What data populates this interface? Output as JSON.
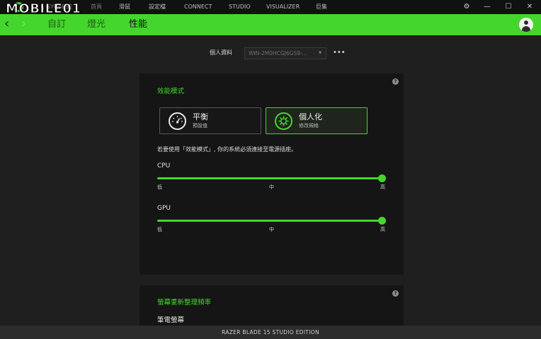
{
  "watermark": "MOBILE01",
  "topnav": {
    "items": [
      "SYNAPSE",
      "首頁",
      "滑鼠",
      "設定檔",
      "CONNECT",
      "STUDIO",
      "VISUALIZER",
      "巨集"
    ]
  },
  "window_controls": {
    "settings": "⚙",
    "minimize": "—",
    "maximize": "☐",
    "close": "✕"
  },
  "header": {
    "tabs": [
      "自訂",
      "燈光",
      "性能"
    ],
    "active_tab": "性能"
  },
  "profile": {
    "label": "個人資料",
    "value": "WIN-2M0HCGJ6GS9-...",
    "more": "•••"
  },
  "performance": {
    "title": "效能模式",
    "modes": [
      {
        "name": "平衡",
        "sub": "預設值",
        "active": false
      },
      {
        "name": "個人化",
        "sub": "修改規格",
        "active": true
      }
    ],
    "note": "若要使用「效能模式」, 你的系統必須連接至電源插座。",
    "sliders": [
      {
        "label": "CPU",
        "level": "高",
        "ticks": [
          "低",
          "中",
          "高"
        ]
      },
      {
        "label": "GPU",
        "level": "高",
        "ticks": [
          "低",
          "中",
          "高"
        ]
      }
    ]
  },
  "refresh": {
    "title": "螢幕重新整理頻率",
    "sub": "筆電螢幕"
  },
  "help_icon": "?",
  "status": "RAZER BLADE 15 STUDIO EDITION",
  "colors": {
    "accent": "#44d62c",
    "background": "#1f1f1f",
    "panel": "#151515"
  }
}
